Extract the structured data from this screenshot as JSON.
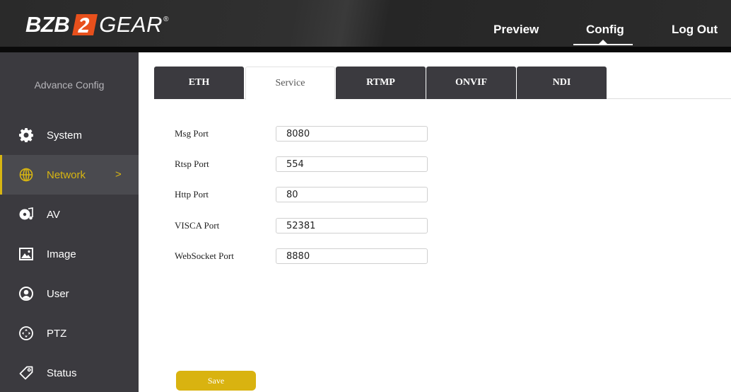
{
  "header": {
    "logo": {
      "part1": "BZB",
      "part2": "GEAR",
      "registered": "®"
    },
    "nav": {
      "preview": "Preview",
      "config": "Config",
      "logout": "Log Out"
    },
    "active_nav": "Config"
  },
  "sidebar": {
    "title": "Advance Config",
    "items": [
      {
        "label": "System",
        "icon": "gear-icon"
      },
      {
        "label": "Network",
        "icon": "globe-icon",
        "active": true,
        "chevron": ">"
      },
      {
        "label": "AV",
        "icon": "av-icon"
      },
      {
        "label": "Image",
        "icon": "image-icon"
      },
      {
        "label": "User",
        "icon": "user-icon"
      },
      {
        "label": "PTZ",
        "icon": "ptz-icon"
      },
      {
        "label": "Status",
        "icon": "tag-icon"
      }
    ]
  },
  "tabs": [
    {
      "label": "ETH"
    },
    {
      "label": "Service",
      "active": true
    },
    {
      "label": "RTMP"
    },
    {
      "label": "ONVIF"
    },
    {
      "label": "NDI"
    }
  ],
  "form": {
    "fields": [
      {
        "label": "Msg Port",
        "value": "8080"
      },
      {
        "label": "Rtsp Port",
        "value": "554"
      },
      {
        "label": "Http Port",
        "value": "80"
      },
      {
        "label": "VISCA Port",
        "value": "52381"
      },
      {
        "label": "WebSocket Port",
        "value": "8880"
      }
    ],
    "save_label": "Save"
  },
  "colors": {
    "accent": "#d7b512",
    "sidebar_bg": "#3b3a3f",
    "header_bg": "#2c2c2c",
    "logo_orange": "#e8501c"
  }
}
